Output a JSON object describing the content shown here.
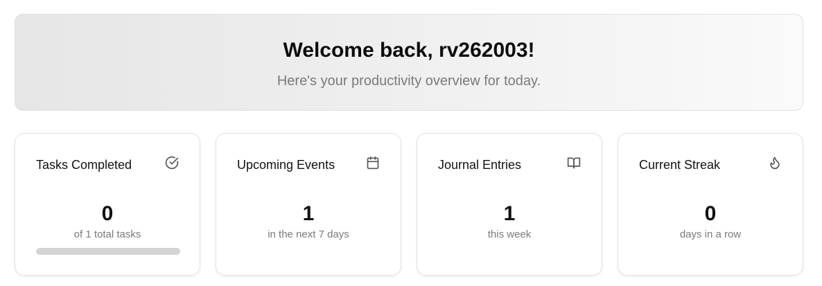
{
  "welcome": {
    "title": "Welcome back, rv262003!",
    "subtitle": "Here's your productivity overview for today."
  },
  "cards": [
    {
      "title": "Tasks Completed",
      "icon": "check-circle-icon",
      "value": "0",
      "subtitle": "of 1 total tasks",
      "progress_fraction": 0
    },
    {
      "title": "Upcoming Events",
      "icon": "calendar-icon",
      "value": "1",
      "subtitle": "in the next 7 days"
    },
    {
      "title": "Journal Entries",
      "icon": "book-open-icon",
      "value": "1",
      "subtitle": "this week"
    },
    {
      "title": "Current Streak",
      "icon": "flame-icon",
      "value": "0",
      "subtitle": "days in a row"
    }
  ],
  "colors": {
    "progress_track": "#d4d4d4",
    "progress_fill": "#111111",
    "muted_text": "#7a7a7a"
  }
}
